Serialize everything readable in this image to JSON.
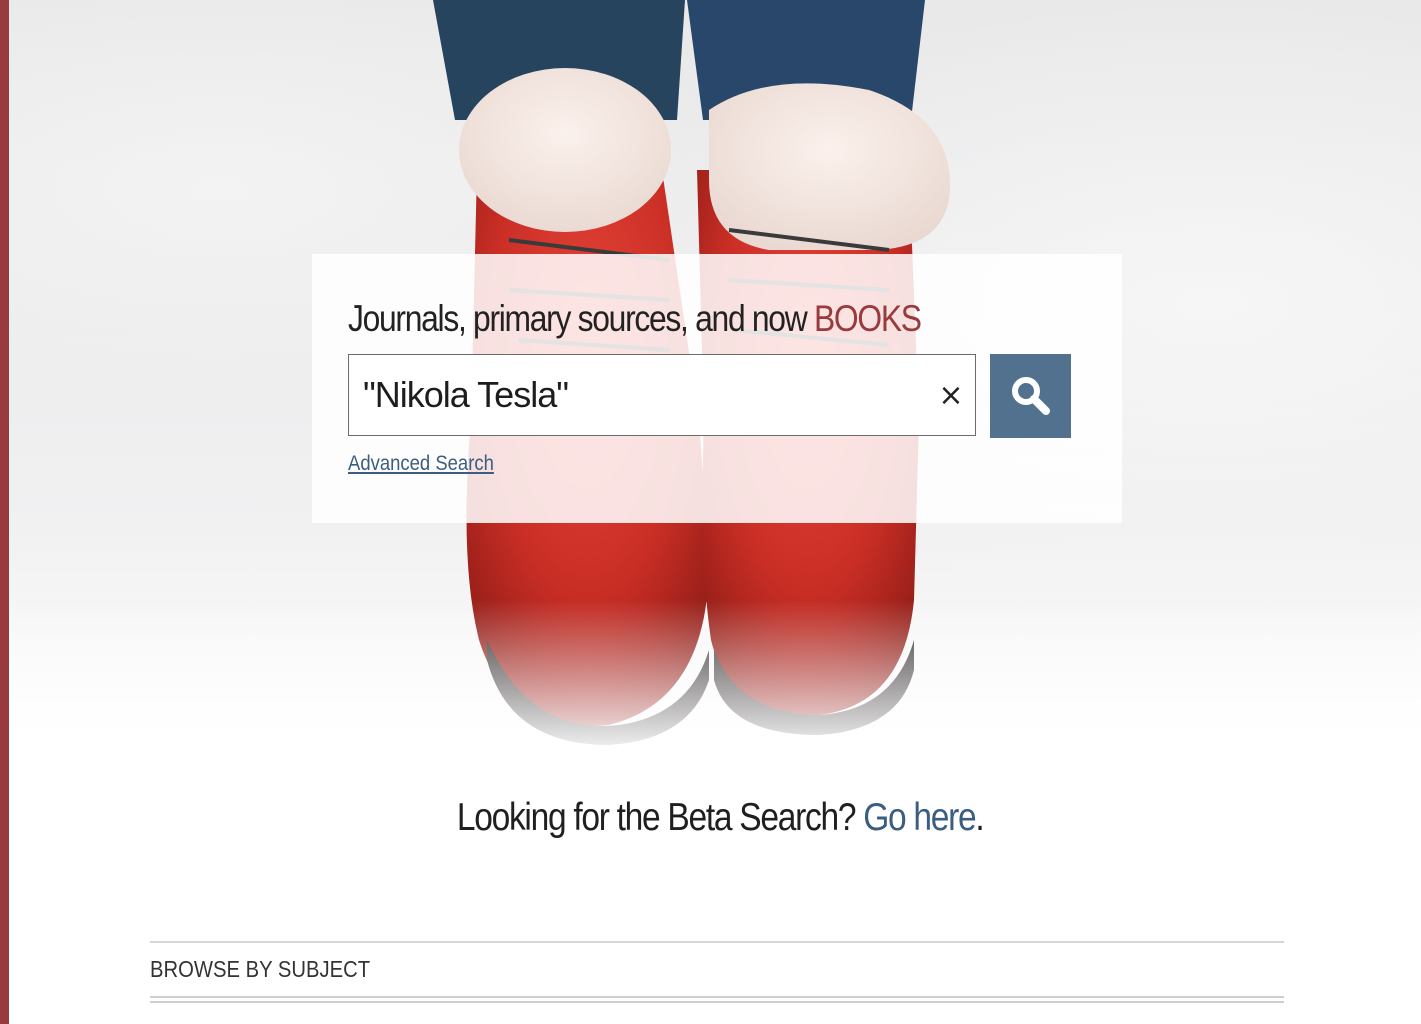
{
  "hero": {
    "image_description_icon": "red-winter-boots-in-snow-photo"
  },
  "search": {
    "heading_prefix": "Journals, primary sources, and now ",
    "heading_accent": "BOOKS",
    "query": "\"Nikola Tesla\"",
    "clear_label": "×",
    "search_icon": "magnifier-icon",
    "advanced_search_label": "Advanced Search"
  },
  "beta": {
    "prompt": "Looking for the Beta Search? ",
    "link_label": "Go here",
    "suffix": "."
  },
  "browse": {
    "heading": "BROWSE BY SUBJECT"
  },
  "colors": {
    "brand": "#993a3e",
    "search_button": "#52718f",
    "link": "#3b5e80",
    "boot_red": "#d0342a"
  }
}
